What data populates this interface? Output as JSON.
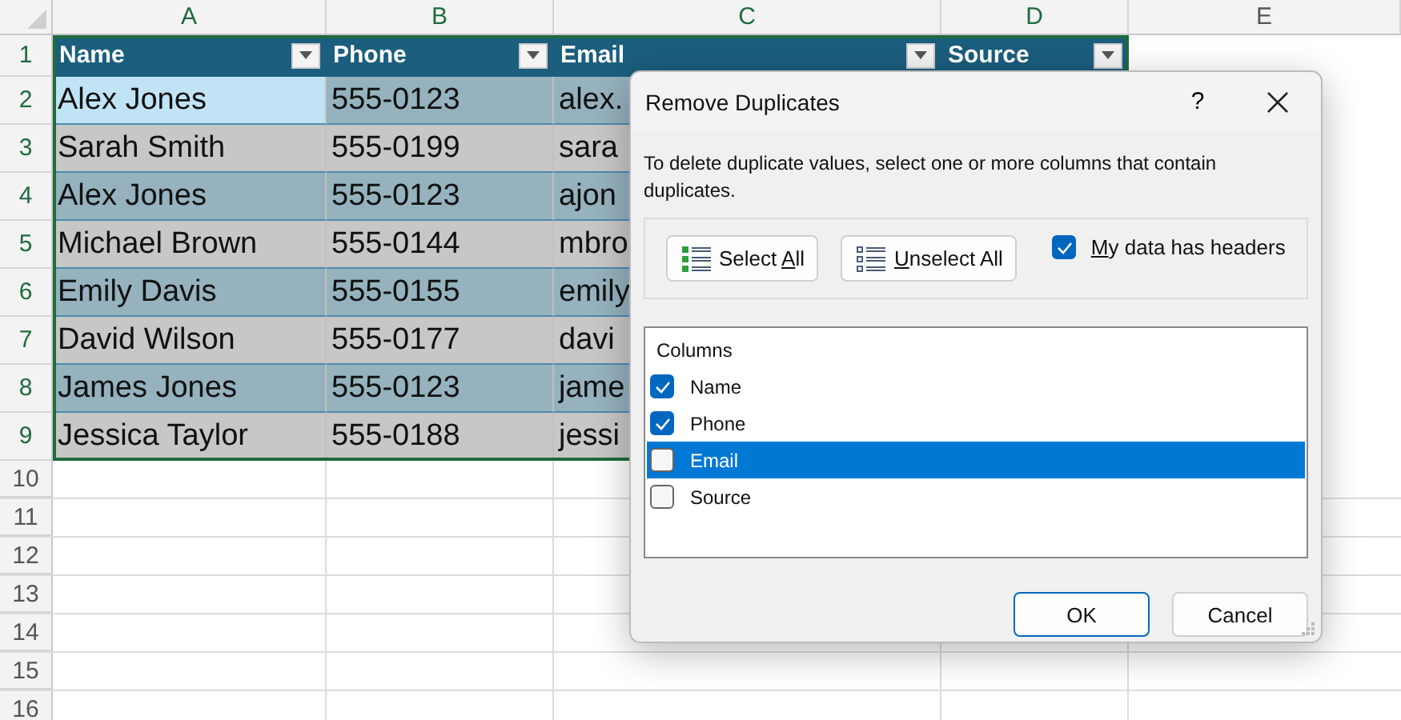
{
  "columns": [
    {
      "letter": "A",
      "selected": true
    },
    {
      "letter": "B",
      "selected": true
    },
    {
      "letter": "C",
      "selected": true
    },
    {
      "letter": "D",
      "selected": true
    },
    {
      "letter": "E",
      "selected": false
    }
  ],
  "header_row": {
    "number": "1",
    "selected": true,
    "cells": [
      "Name",
      "Phone",
      "Email",
      "Source"
    ]
  },
  "rows": [
    {
      "number": "2",
      "selected": true,
      "cells": [
        {
          "text": "Alex Jones",
          "active": true
        },
        {
          "text": "555-0123",
          "active": false
        },
        {
          "text": "alex.",
          "active": false
        }
      ]
    },
    {
      "number": "3",
      "selected": true,
      "cells": [
        {
          "text": "Sarah Smith",
          "active": false
        },
        {
          "text": "555-0199",
          "active": false
        },
        {
          "text": "sara",
          "active": false
        }
      ]
    },
    {
      "number": "4",
      "selected": true,
      "cells": [
        {
          "text": "Alex Jones",
          "active": false
        },
        {
          "text": "555-0123",
          "active": false
        },
        {
          "text": "ajon",
          "active": false
        }
      ]
    },
    {
      "number": "5",
      "selected": true,
      "cells": [
        {
          "text": "Michael Brown",
          "active": false
        },
        {
          "text": "555-0144",
          "active": false
        },
        {
          "text": "mbro",
          "active": false
        }
      ]
    },
    {
      "number": "6",
      "selected": true,
      "cells": [
        {
          "text": "Emily Davis",
          "active": false
        },
        {
          "text": "555-0155",
          "active": false
        },
        {
          "text": "emily",
          "active": false
        }
      ]
    },
    {
      "number": "7",
      "selected": true,
      "cells": [
        {
          "text": "David Wilson",
          "active": false
        },
        {
          "text": "555-0177",
          "active": false
        },
        {
          "text": "davi",
          "active": false
        }
      ]
    },
    {
      "number": "8",
      "selected": true,
      "cells": [
        {
          "text": "James Jones",
          "active": false
        },
        {
          "text": "555-0123",
          "active": false
        },
        {
          "text": "jame",
          "active": false
        }
      ]
    },
    {
      "number": "9",
      "selected": true,
      "cells": [
        {
          "text": "Jessica Taylor",
          "active": false
        },
        {
          "text": "555-0188",
          "active": false
        },
        {
          "text": "jessi",
          "active": false
        }
      ]
    }
  ],
  "empty_rows": [
    {
      "number": "10",
      "selected": false
    },
    {
      "number": "11",
      "selected": false
    },
    {
      "number": "12",
      "selected": false
    },
    {
      "number": "13",
      "selected": false
    },
    {
      "number": "14",
      "selected": false
    },
    {
      "number": "15",
      "selected": false
    },
    {
      "number": "16",
      "selected": false
    }
  ],
  "dialog": {
    "title": "Remove Duplicates",
    "help": "?",
    "description": "To delete duplicate values, select one or more columns that contain duplicates.",
    "buttons": [
      {
        "kind": "select",
        "label": {
          "before": "Select ",
          "key": "A",
          "after": "ll"
        }
      },
      {
        "kind": "unselect",
        "label": {
          "key": "U",
          "after": "nselect All"
        }
      }
    ],
    "headers_checkbox": {
      "label": {
        "key": "M",
        "after": "y data has headers"
      },
      "checked": true
    },
    "list_title": "Columns",
    "items": [
      {
        "label": "Name",
        "checked": true,
        "selected": false
      },
      {
        "label": "Phone",
        "checked": true,
        "selected": false
      },
      {
        "label": "Email",
        "checked": false,
        "selected": true
      },
      {
        "label": "Source",
        "checked": false,
        "selected": false
      }
    ],
    "ok": "OK",
    "cancel": "Cancel"
  }
}
